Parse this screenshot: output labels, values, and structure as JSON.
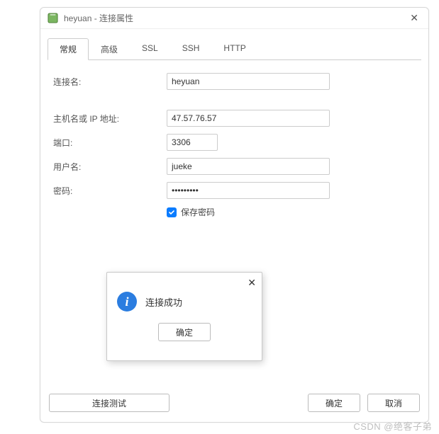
{
  "window": {
    "title": "heyuan - 连接属性"
  },
  "tabs": {
    "items": [
      "常规",
      "高级",
      "SSL",
      "SSH",
      "HTTP"
    ],
    "active": 0
  },
  "form": {
    "conn_name_label": "连接名:",
    "conn_name_value": "heyuan",
    "host_label": "主机名或 IP 地址:",
    "host_value": "47.57.76.57",
    "port_label": "端口:",
    "port_value": "3306",
    "user_label": "用户名:",
    "user_value": "jueke",
    "pass_label": "密码:",
    "pass_value": "•••••••••",
    "save_pass_label": "保存密码",
    "save_pass_checked": true
  },
  "footer": {
    "test_label": "连接测试",
    "ok_label": "确定",
    "cancel_label": "取消"
  },
  "modal": {
    "message": "连接成功",
    "ok_label": "确定"
  },
  "watermark": "CSDN @绝客子弟"
}
